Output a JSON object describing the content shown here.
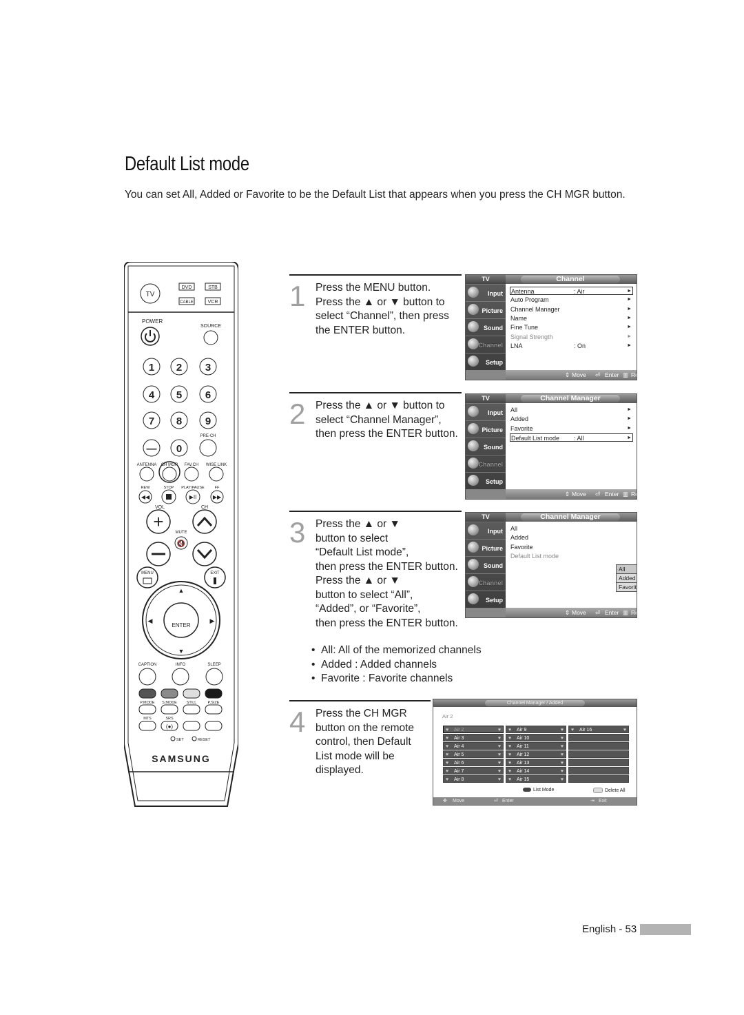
{
  "page": {
    "title": "Default List mode",
    "intro": "You can set All, Added or Favorite to be the Default List that appears when you press the CH MGR button.",
    "footer_label": "English - 53"
  },
  "remote": {
    "brand": "SAMSUNG",
    "mode_buttons": [
      "TV",
      "DVD",
      "STB",
      "CABLE",
      "VCR"
    ],
    "power_label": "POWER",
    "source_label": "SOURCE",
    "digits": [
      "1",
      "2",
      "3",
      "4",
      "5",
      "6",
      "7",
      "8",
      "9",
      "—",
      "0"
    ],
    "prech_label": "PRE-CH",
    "row_labels": [
      "ANTENNA",
      "CH MGR",
      "FAV.CH",
      "WISE LINK"
    ],
    "transport_labels": [
      "REW",
      "STOP",
      "PLAY/PAUSE",
      "FF"
    ],
    "vol_label": "VOL",
    "ch_label": "CH",
    "mute_label": "MUTE",
    "menu_label": "MENU",
    "exit_label": "EXIT",
    "enter_label": "ENTER",
    "func_labels": [
      "CAPTION",
      "INFO",
      "SLEEP"
    ],
    "color_labels": [
      "P.MODE",
      "S.MODE",
      "STILL",
      "P.SIZE"
    ],
    "mts_label": "MTS",
    "srs_label": "SRS",
    "srs_glyph": "(●)",
    "set_label": "SET",
    "reset_label": "RESET",
    "color_keys": [
      "#555555",
      "#8a8a8a",
      "#dedede",
      "#1a1a1a"
    ]
  },
  "steps": [
    {
      "num": "1",
      "text": "Press the MENU button.\nPress the ▲ or ▼ button to\nselect “Channel”, then press\nthe ENTER button."
    },
    {
      "num": "2",
      "text": "Press the ▲ or ▼ button to\nselect “Channel Manager”,\nthen press the ENTER button."
    },
    {
      "num": "3",
      "text": "Press the ▲ or ▼\nbutton to select\n“Default List mode”,\nthen press the ENTER button.\nPress the ▲ or ▼\nbutton to select “All”,\n“Added”, or “Favorite”,\nthen press the ENTER button."
    },
    {
      "num": "4",
      "text": "Press the CH MGR\nbutton on the remote\ncontrol, then Default\nList mode will be\ndisplayed."
    }
  ],
  "bullets": [
    "All: All of the memorized channels",
    "Added : Added channels",
    "Favorite : Favorite channels"
  ],
  "osd_common": {
    "tv_label": "TV",
    "side_items": [
      "Input",
      "Picture",
      "Sound",
      "Channel",
      "Setup"
    ],
    "footer": {
      "move": "Move",
      "enter": "Enter",
      "return": "Return"
    },
    "arrow": "►",
    "move_icon": "⇕"
  },
  "osd1": {
    "title": "Channel",
    "rows": [
      {
        "label": "Antenna",
        "value": ": Air"
      },
      {
        "label": "Auto Program",
        "value": ""
      },
      {
        "label": "Channel Manager",
        "value": ""
      },
      {
        "label": "Name",
        "value": ""
      },
      {
        "label": "Fine Tune",
        "value": ""
      },
      {
        "label": "Signal Strength",
        "value": ""
      },
      {
        "label": "LNA",
        "value": ": On"
      }
    ]
  },
  "osd2": {
    "title": "Channel Manager",
    "rows": [
      {
        "label": "All",
        "value": ""
      },
      {
        "label": "Added",
        "value": ""
      },
      {
        "label": "Favorite",
        "value": ""
      },
      {
        "label": "Default List mode",
        "value": ": All"
      }
    ]
  },
  "osd3": {
    "title": "Channel Manager",
    "rows": [
      {
        "label": "All"
      },
      {
        "label": "Added"
      },
      {
        "label": "Favorite"
      },
      {
        "label": "Default List mode"
      }
    ],
    "options": [
      "All",
      "Added",
      "Favorite"
    ],
    "selected_option": "All"
  },
  "chmgr": {
    "title": "Channel Manager / Added",
    "current": "Air 2",
    "columns": [
      [
        "Air 2",
        "Air 3",
        "Air 4",
        "Air 5",
        "Air 6",
        "Air 7",
        "Air 8"
      ],
      [
        "Air 9",
        "Air 10",
        "Air 11",
        "Air 12",
        "Air 13",
        "Air 14",
        "Air 15"
      ],
      [
        "Air 16",
        "",
        "",
        "",
        "",
        "",
        ""
      ]
    ],
    "legend": {
      "list_mode": "List Mode",
      "delete_all": "Delete All"
    },
    "footer": {
      "move": "Move",
      "enter": "Enter",
      "exit": "Exit"
    },
    "heart_icon": "♥"
  }
}
